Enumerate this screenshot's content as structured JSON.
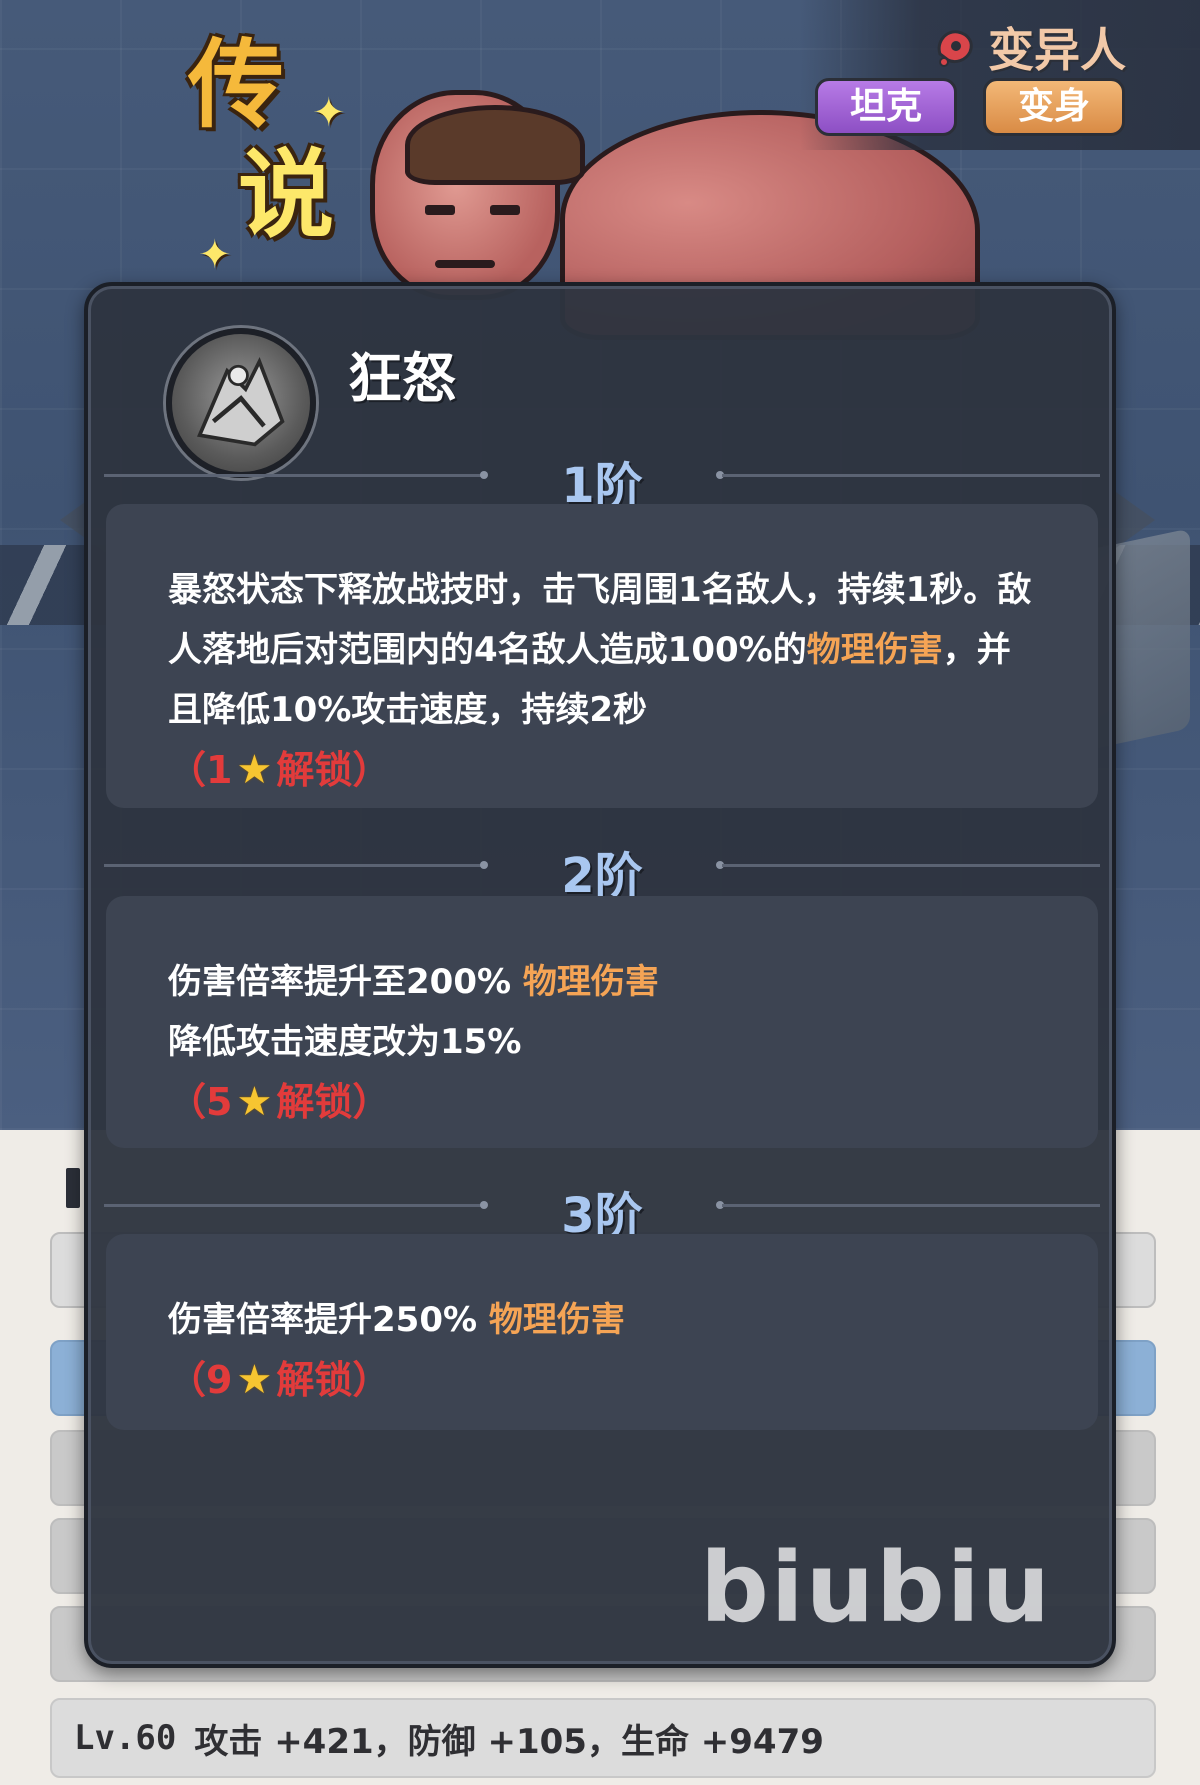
{
  "hero": {
    "rarity": "传说",
    "rarity_line1": "传",
    "rarity_line2": "说",
    "faction": "变异人",
    "tags": [
      "坦克",
      "变身"
    ]
  },
  "skill": {
    "name": "狂怒",
    "tiers": [
      {
        "label": "1阶",
        "text_parts": [
          "暴怒状态下释放战技时，击飞周围1名敌人，持续1秒。敌人落地后对范围内的4名敌人造成100%的",
          "物理伤害",
          "，并且降低10%攻击速度，持续2秒"
        ],
        "unlock_stars": "1",
        "unlock_label": "解锁",
        "open_paren": "（",
        "close_paren": "）"
      },
      {
        "label": "2阶",
        "line1_text": "伤害倍率提升至200%",
        "line1_highlight": "物理伤害",
        "line2": "降低攻击速度改为15%",
        "unlock_stars": "5",
        "unlock_label": "解锁",
        "open_paren": "（",
        "close_paren": "）"
      },
      {
        "label": "3阶",
        "line1_text": "伤害倍率提升250%",
        "line1_highlight": "物理伤害",
        "unlock_stars": "9",
        "unlock_label": "解锁",
        "open_paren": "（",
        "close_paren": "）"
      }
    ]
  },
  "stats_final": {
    "level": "Lv.60",
    "text": "攻击 +421，防御 +105，生命 +9479"
  },
  "watermark": "biubiu",
  "colors": {
    "highlight": "#f5a455",
    "unlock": "#e23b3b",
    "tier_label": "#a9c7f0",
    "tag_tank": "#9a5fd3",
    "tag_transform": "#e69d55"
  }
}
